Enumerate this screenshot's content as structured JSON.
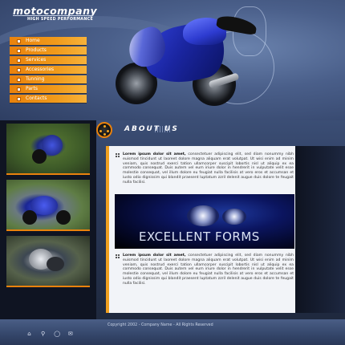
{
  "brand": {
    "logo": "motocompany",
    "tagline": "HIGH SPEED PERFORMANCE"
  },
  "nav": {
    "items": [
      {
        "label": "Home"
      },
      {
        "label": "Products"
      },
      {
        "label": "Services"
      },
      {
        "label": "Accessories"
      },
      {
        "label": "Tunning"
      },
      {
        "label": "Parts"
      },
      {
        "label": "Contacts"
      }
    ]
  },
  "about": {
    "title": "ABOUT US"
  },
  "content": {
    "paragraph1_lead": "Lorem ipsum dolor sit amet,",
    "paragraph1_body": " consectetuer adipiscing elit, sed diam nonummy nibh euismod tincidunt ut laoreet dolore magna aliquam erat volutpat. Ut wisi enim ad minim veniam, quis nostrud exerci tation ullamcorper suscipit lobortis nisl ut aliquip ex ea commodo consequat. Duis autem vel eum iriure dolor in hendrerit in vulputate velit esse molestie consequat, vel illum dolore eu feugiat nulla facilisis at vero eros et accumsan et iusto odio dignissim qui blandit praesent luptatum zzril delenit augue duis dolore te feugait nulla facilisi.",
    "banner_text": "Excellent Forms",
    "paragraph2_lead": "Lorem ipsum dolor sit amet,",
    "paragraph2_body": " consectetuer adipiscing elit, sed diam nonummy nibh euismod tincidunt ut laoreet dolore magna aliquam erat volutpat. Ut wisi enim ad minim veniam, quis nostrud exerci tation ullamcorper suscipit lobortis nisl ut aliquip ex ea commodo consequat. Duis autem vel eum iriure dolor in hendrerit in vulputate velit esse molestie consequat, vel illum dolore eu feugiat nulla facilisis at vero eros et accumsan et iusto odio dignissim qui blandit praesent luptatum zzril delenit augue duis dolore te feugait nulla facilisi."
  },
  "footer": {
    "copyright": "Copyright 2002 - Company Name - All Rights Reserved",
    "icons": [
      "home-icon",
      "sitemap-icon",
      "search-icon",
      "mail-icon"
    ]
  },
  "colors": {
    "accent": "#e9820d",
    "background": "#2e3f63",
    "panel": "#f2f4f8"
  }
}
